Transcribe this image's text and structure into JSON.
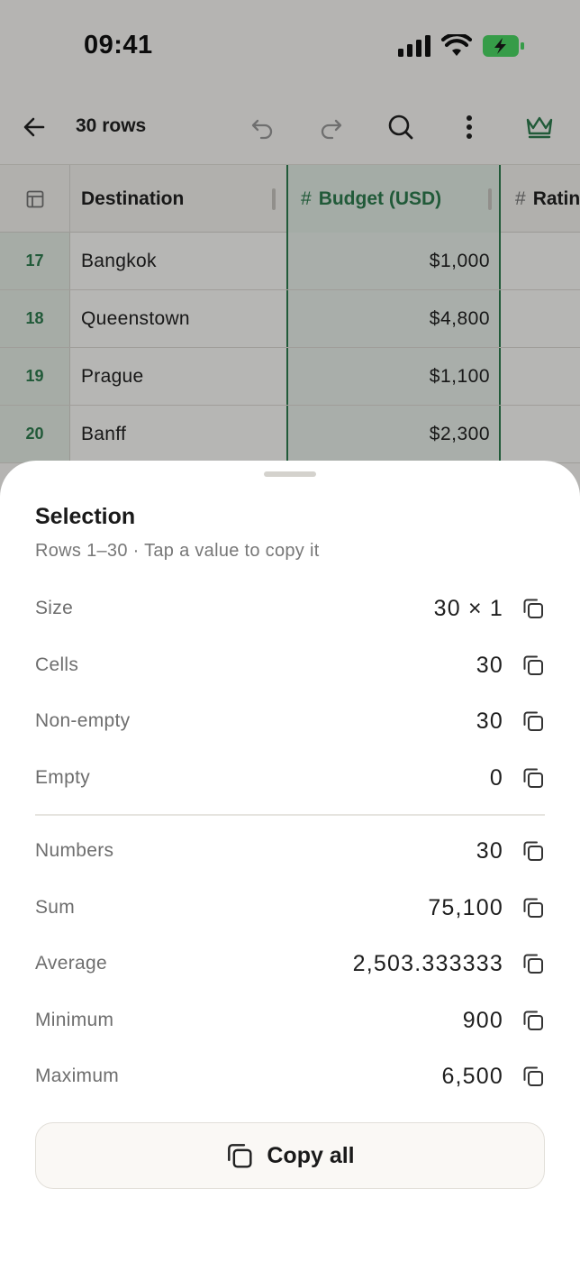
{
  "status_bar": {
    "time": "09:41"
  },
  "toolbar": {
    "rows_label": "30 rows"
  },
  "grid": {
    "columns": [
      {
        "name": "Destination"
      },
      {
        "name": "Budget (USD)"
      },
      {
        "name": "Ratin"
      }
    ],
    "type_marker": "#",
    "rows": [
      {
        "num": "17",
        "destination": "Bangkok",
        "budget": "$1,000"
      },
      {
        "num": "18",
        "destination": "Queenstown",
        "budget": "$4,800"
      },
      {
        "num": "19",
        "destination": "Prague",
        "budget": "$1,100"
      },
      {
        "num": "20",
        "destination": "Banff",
        "budget": "$2,300"
      }
    ]
  },
  "sheet": {
    "title": "Selection",
    "subtitle": "Rows 1–30 · Tap a value to copy it",
    "stats": [
      {
        "label": "Size",
        "value": "30 × 1"
      },
      {
        "label": "Cells",
        "value": "30"
      },
      {
        "label": "Non-empty",
        "value": "30"
      },
      {
        "label": "Empty",
        "value": "0"
      },
      {
        "label": "Numbers",
        "value": "30"
      },
      {
        "label": "Sum",
        "value": "75,100"
      },
      {
        "label": "Average",
        "value": "2,503.333333"
      },
      {
        "label": "Minimum",
        "value": "900"
      },
      {
        "label": "Maximum",
        "value": "6,500"
      }
    ],
    "copy_all_label": "Copy all"
  },
  "colors": {
    "accent": "#2f7d4f",
    "battery": "#4cd964"
  }
}
